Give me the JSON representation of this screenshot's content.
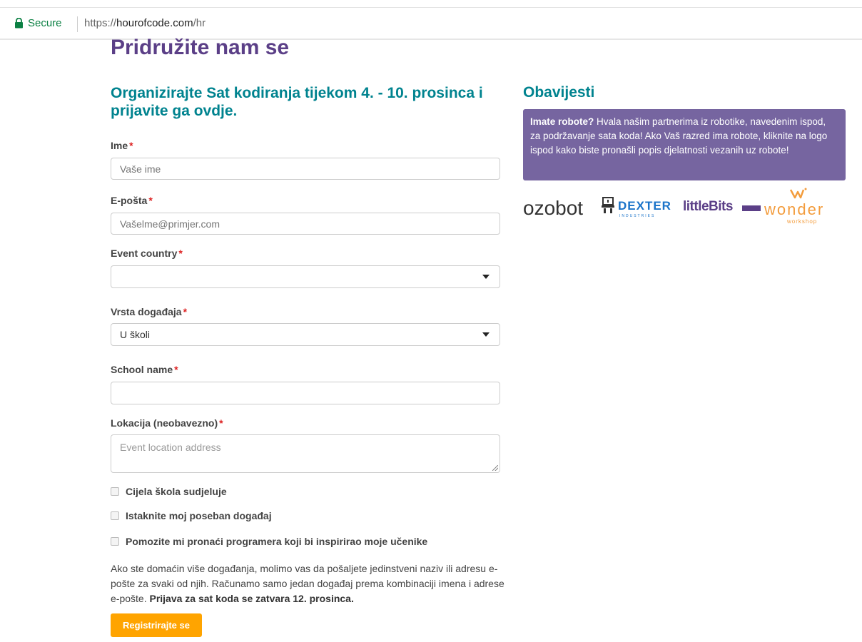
{
  "browser": {
    "secure_label": "Secure",
    "url_scheme": "https://",
    "url_host": "hourofcode.com",
    "url_path": "/hr"
  },
  "page": {
    "title": "Pridružite nam se",
    "form_heading": "Organizirajte Sat kodiranja tijekom 4. - 10. prosinca i prijavite ga ovdje."
  },
  "form": {
    "required_mark": "*",
    "name": {
      "label": "Ime",
      "placeholder": "Vaše ime"
    },
    "email": {
      "label": "E-pošta",
      "placeholder": "Vašelme@primjer.com"
    },
    "event_country": {
      "label": "Event country",
      "value": ""
    },
    "event_type": {
      "label": "Vrsta događaja",
      "value": "U školi"
    },
    "school_name": {
      "label": "School name",
      "value": ""
    },
    "location": {
      "label": "Lokacija (neobavezno)",
      "placeholder": "Event location address"
    },
    "checkboxes": [
      {
        "label": "Cijela škola sudjeluje",
        "checked": false
      },
      {
        "label": "Istaknite moj poseban događaj",
        "checked": false
      },
      {
        "label": "Pomozite mi pronaći programera koji bi inspirirao moje učenike",
        "checked": false
      }
    ],
    "info_text": "Ako ste domaćin više događanja, molimo vas da pošaljete jedinstveni naziv ili adresu e-pošte za svaki od njih. Računamo samo jedan događaj prema kombinaciji imena i adrese e-pošte.",
    "info_bold": "Prijava za sat koda se zatvara 12. prosinca.",
    "submit_label": "Registrirajte se"
  },
  "notifications": {
    "heading": "Obavijesti",
    "box_bold": "Imate robote?",
    "box_text": "Hvala našim partnerima iz robotike, navedenim ispod, za podržavanje sata koda! Ako Vaš razred ima robote, kliknite na logo ispod kako biste pronašli popis djelatnosti vezanih uz robote!",
    "logos": {
      "ozobot": "ozobot",
      "dexter": "DEXTER",
      "dexter_sub": "INDUSTRIES",
      "littlebits": "littleBits",
      "wonder": "wonder",
      "wonder_sub": "workshop"
    }
  },
  "colors": {
    "title_purple": "#5b3f87",
    "heading_teal": "#00838f",
    "notif_box": "#7665a0",
    "button_orange": "#ffa400",
    "required_red": "#dd2222"
  }
}
